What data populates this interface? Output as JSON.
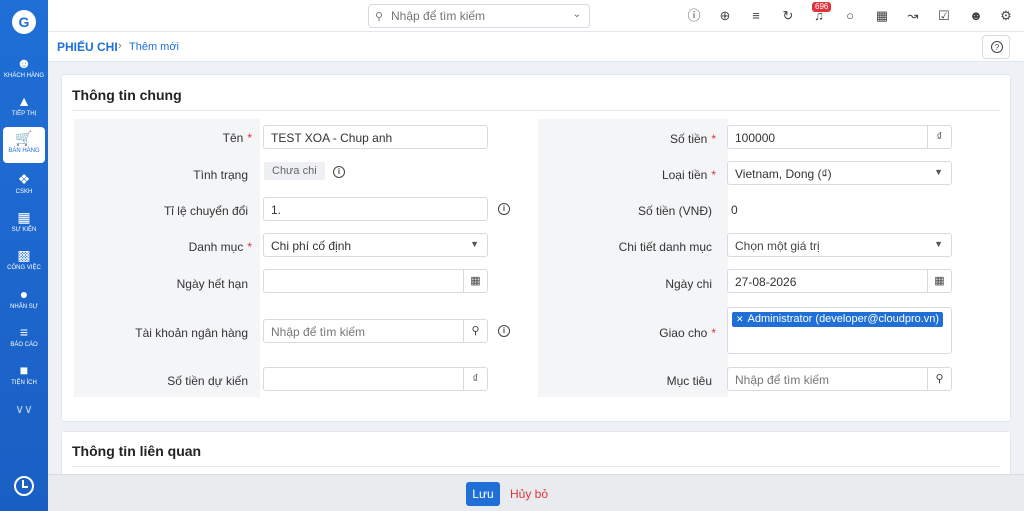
{
  "sidebar": {
    "logo_icon": "brand-logo-icon",
    "items": [
      {
        "label": "KHÁCH HÀNG",
        "icon": "users-icon"
      },
      {
        "label": "TIẾP THỊ",
        "icon": "megaphone-icon"
      },
      {
        "label": "BÁN HÀNG",
        "icon": "cart-icon",
        "active": true
      },
      {
        "label": "CSKH",
        "icon": "lifebuoy-icon"
      },
      {
        "label": "SỰ KIỆN",
        "icon": "calendar-icon"
      },
      {
        "label": "CÔNG VIỆC",
        "icon": "briefcase-icon"
      },
      {
        "label": "NHÂN SỰ",
        "icon": "person-icon"
      },
      {
        "label": "BÁO CÁO",
        "icon": "chart-icon"
      },
      {
        "label": "TIỆN ÍCH",
        "icon": "box-icon"
      }
    ]
  },
  "topbar": {
    "search_placeholder": "Nhập để tìm kiếm",
    "notification_count": "696"
  },
  "breadcrumb": {
    "module": "PHIẾU CHI",
    "current": "Thêm mới"
  },
  "sections": {
    "general_title": "Thông tin chung",
    "related_title": "Thông tin liên quan"
  },
  "form": {
    "left": {
      "name_label": "Tên",
      "name_value": "TEST XOA - Chup anh",
      "status_label": "Tình trạng",
      "status_value": "Chưa chi",
      "rate_label": "Tỉ lệ chuyển đổi",
      "rate_value": "1.",
      "category_label": "Danh mục",
      "category_value": "Chi phí cố định",
      "expiry_label": "Ngày hết hạn",
      "bank_label": "Tài khoản ngân hàng",
      "bank_placeholder": "Nhập để tìm kiếm",
      "estimated_label": "Số tiền dự kiến",
      "currency_symbol": "₫"
    },
    "right": {
      "amount_label": "Số tiền",
      "amount_value": "100000",
      "currency_symbol": "₫",
      "currency_type_label": "Loại tiền",
      "currency_type_value": "Vietnam, Dong (₫)",
      "amount_vnd_label": "Số tiền (VNĐ)",
      "amount_vnd_value": "0",
      "category_detail_label": "Chi tiết danh mục",
      "category_detail_value": "Chọn một giá trị",
      "pay_date_label": "Ngày chi",
      "pay_date_value": "27-08-2026",
      "assignee_label": "Giao cho",
      "assignee_value": "Administrator (developer@cloudpro.vn)",
      "target_label": "Mục tiêu",
      "target_placeholder": "Nhập để tìm kiếm"
    }
  },
  "footer": {
    "save_label": "Lưu",
    "cancel_label": "Hủy bỏ"
  },
  "colors": {
    "primary": "#1f6fd6",
    "required": "#e0363b"
  }
}
